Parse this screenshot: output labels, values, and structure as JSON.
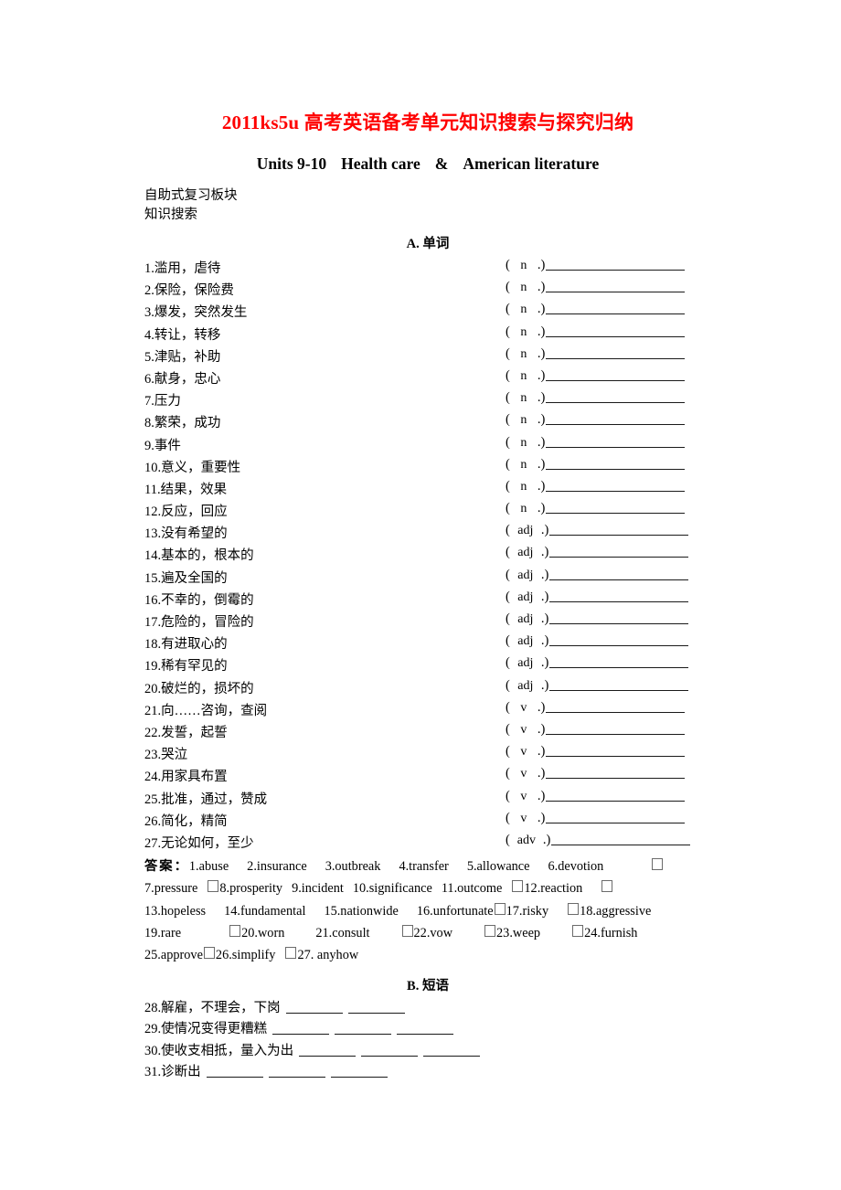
{
  "document": {
    "title": "2011ks5u 高考英语备考单元知识搜索与探究归纳",
    "title_color": "#ff0000",
    "subtitle_left": "Units 9-10",
    "subtitle_mid": "Health care",
    "subtitle_amp": "&",
    "subtitle_right": "American literature",
    "intro_line_1": "自助式复习板块",
    "intro_line_2": "知识搜索"
  },
  "section_a": {
    "heading_letter": "A.",
    "heading_text": "单词",
    "items": [
      {
        "num": "1.",
        "cn": "滥用，虐待",
        "pos": "n",
        "pos_class": "w-n"
      },
      {
        "num": "2.",
        "cn": "保险，保险费",
        "pos": "n",
        "pos_class": "w-n"
      },
      {
        "num": "3.",
        "cn": "爆发，突然发生",
        "pos": "n",
        "pos_class": "w-n"
      },
      {
        "num": "4.",
        "cn": "转让，转移",
        "pos": "n",
        "pos_class": "w-n"
      },
      {
        "num": "5.",
        "cn": "津贴，补助",
        "pos": "n",
        "pos_class": "w-n"
      },
      {
        "num": "6.",
        "cn": "献身，忠心",
        "pos": "n",
        "pos_class": "w-n"
      },
      {
        "num": "7.",
        "cn": "压力",
        "pos": "n",
        "pos_class": "w-n"
      },
      {
        "num": "8.",
        "cn": "繁荣，成功",
        "pos": "n",
        "pos_class": "w-n"
      },
      {
        "num": "9.",
        "cn": "事件",
        "pos": "n",
        "pos_class": "w-n"
      },
      {
        "num": "10.",
        "cn": "意义，重要性",
        "pos": "n",
        "pos_class": "w-n"
      },
      {
        "num": "11.",
        "cn": "结果，效果",
        "pos": "n",
        "pos_class": "w-n"
      },
      {
        "num": "12.",
        "cn": "反应，回应",
        "pos": "n",
        "pos_class": "w-n"
      },
      {
        "num": "13.",
        "cn": "没有希望的",
        "pos": "adj",
        "pos_class": "w-adj"
      },
      {
        "num": "14.",
        "cn": "基本的，根本的",
        "pos": "adj",
        "pos_class": "w-adj"
      },
      {
        "num": "15.",
        "cn": "遍及全国的",
        "pos": "adj",
        "pos_class": "w-adj"
      },
      {
        "num": "16.",
        "cn": "不幸的，倒霉的",
        "pos": "adj",
        "pos_class": "w-adj"
      },
      {
        "num": "17.",
        "cn": "危险的，冒险的",
        "pos": "adj",
        "pos_class": "w-adj"
      },
      {
        "num": "18.",
        "cn": "有进取心的",
        "pos": "adj",
        "pos_class": "w-adj"
      },
      {
        "num": "19.",
        "cn": "稀有罕见的",
        "pos": "adj",
        "pos_class": "w-adj"
      },
      {
        "num": "20.",
        "cn": "破烂的，损坏的",
        "pos": "adj",
        "pos_class": "w-adj"
      },
      {
        "num": "21.",
        "cn": "向……咨询，查阅",
        "pos": "v",
        "pos_class": "w-v"
      },
      {
        "num": "22.",
        "cn": "发誓，起誓",
        "pos": "v",
        "pos_class": "w-v"
      },
      {
        "num": "23.",
        "cn": "哭泣",
        "pos": "v",
        "pos_class": "w-v"
      },
      {
        "num": "24.",
        "cn": "用家具布置",
        "pos": "v",
        "pos_class": "w-v"
      },
      {
        "num": "25.",
        "cn": "批准，通过，赞成",
        "pos": "v",
        "pos_class": "w-v"
      },
      {
        "num": "26.",
        "cn": "简化，精简",
        "pos": "v",
        "pos_class": "w-v"
      },
      {
        "num": "27.",
        "cn": "无论如何，至少",
        "pos": "adv",
        "pos_class": "w-adv"
      }
    ]
  },
  "answer_key": {
    "label": "答案：",
    "lines": [
      [
        {
          "t": "text",
          "v": "1.abuse"
        },
        {
          "t": "sp",
          "v": "sp-m"
        },
        {
          "t": "text",
          "v": "2.insurance"
        },
        {
          "t": "sp",
          "v": "sp-m"
        },
        {
          "t": "text",
          "v": "3.outbreak"
        },
        {
          "t": "sp",
          "v": "sp-m"
        },
        {
          "t": "text",
          "v": "4.transfer"
        },
        {
          "t": "sp",
          "v": "sp-m"
        },
        {
          "t": "text",
          "v": "5.allowance"
        },
        {
          "t": "sp",
          "v": "sp-m"
        },
        {
          "t": "text",
          "v": "6.devotion"
        },
        {
          "t": "sp",
          "v": "sp-xl"
        },
        {
          "t": "tofu"
        }
      ],
      [
        {
          "t": "text",
          "v": "7.pressure"
        },
        {
          "t": "sp",
          "v": "sp-s"
        },
        {
          "t": "tofu"
        },
        {
          "t": "text",
          "v": "8.prosperity"
        },
        {
          "t": "sp",
          "v": "sp-s"
        },
        {
          "t": "text",
          "v": "9.incident"
        },
        {
          "t": "sp",
          "v": "sp-s"
        },
        {
          "t": "text",
          "v": "10.significance"
        },
        {
          "t": "sp",
          "v": "sp-s"
        },
        {
          "t": "text",
          "v": "11.outcome"
        },
        {
          "t": "sp",
          "v": "sp-s"
        },
        {
          "t": "tofu"
        },
        {
          "t": "text",
          "v": "12.reaction"
        },
        {
          "t": "sp",
          "v": "sp-m"
        },
        {
          "t": "tofu"
        }
      ],
      [
        {
          "t": "text",
          "v": "13.hopeless"
        },
        {
          "t": "sp",
          "v": "sp-m"
        },
        {
          "t": "text",
          "v": "14.fundamental"
        },
        {
          "t": "sp",
          "v": "sp-m"
        },
        {
          "t": "text",
          "v": "15.nationwide"
        },
        {
          "t": "sp",
          "v": "sp-m"
        },
        {
          "t": "text",
          "v": "16.unfortunate"
        },
        {
          "t": "tofu"
        },
        {
          "t": "text",
          "v": "17.risky"
        },
        {
          "t": "sp",
          "v": "sp-m"
        },
        {
          "t": "tofu"
        },
        {
          "t": "text",
          "v": "18.aggressive"
        }
      ],
      [
        {
          "t": "text",
          "v": "19.rare"
        },
        {
          "t": "sp",
          "v": "sp-xl"
        },
        {
          "t": "tofu"
        },
        {
          "t": "text",
          "v": "20.worn"
        },
        {
          "t": "sp",
          "v": "sp-l"
        },
        {
          "t": "text",
          "v": "21.consult"
        },
        {
          "t": "sp",
          "v": "sp-l"
        },
        {
          "t": "tofu"
        },
        {
          "t": "text",
          "v": "22.vow"
        },
        {
          "t": "sp",
          "v": "sp-l"
        },
        {
          "t": "tofu"
        },
        {
          "t": "text",
          "v": "23.weep"
        },
        {
          "t": "sp",
          "v": "sp-l"
        },
        {
          "t": "tofu"
        },
        {
          "t": "text",
          "v": "24.furnish"
        }
      ],
      [
        {
          "t": "text",
          "v": "25.approve"
        },
        {
          "t": "tofu"
        },
        {
          "t": "text",
          "v": "26.simplify"
        },
        {
          "t": "sp",
          "v": "sp-s"
        },
        {
          "t": "tofu"
        },
        {
          "t": "text",
          "v": "27. anyhow"
        }
      ]
    ]
  },
  "section_b": {
    "heading_letter": "B.",
    "heading_text": "短语",
    "items": [
      {
        "num": "28.",
        "cn": "解雇，不理会，下岗",
        "blanks": 2
      },
      {
        "num": "29.",
        "cn": "使情况变得更糟糕",
        "blanks": 3
      },
      {
        "num": "30.",
        "cn": "使收支相抵，量入为出",
        "blanks": 3
      },
      {
        "num": "31.",
        "cn": "诊断出",
        "blanks": 3
      }
    ]
  }
}
